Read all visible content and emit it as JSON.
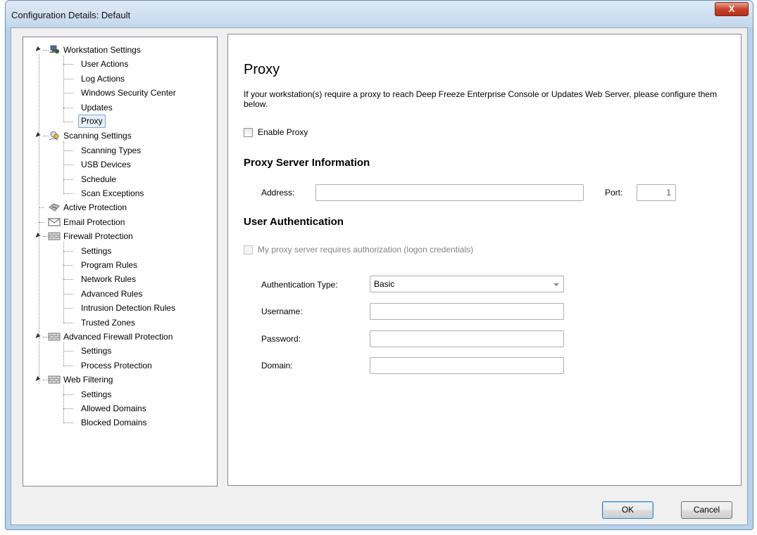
{
  "window": {
    "title": "Configuration Details: Default",
    "close_label": "X"
  },
  "tree": {
    "items": [
      {
        "label": "Workstation Settings",
        "level": 0,
        "icon": "workstation-icon"
      },
      {
        "label": "User Actions",
        "level": 1
      },
      {
        "label": "Log Actions",
        "level": 1
      },
      {
        "label": "Windows Security Center",
        "level": 1
      },
      {
        "label": "Updates",
        "level": 1
      },
      {
        "label": "Proxy",
        "level": 1,
        "selected": true
      },
      {
        "label": "Scanning Settings",
        "level": 0,
        "icon": "scanning-icon"
      },
      {
        "label": "Scanning Types",
        "level": 1
      },
      {
        "label": "USB Devices",
        "level": 1
      },
      {
        "label": "Schedule",
        "level": 1
      },
      {
        "label": "Scan Exceptions",
        "level": 1
      },
      {
        "label": "Active Protection",
        "level": 0,
        "icon": "active-protection-icon"
      },
      {
        "label": "Email Protection",
        "level": 0,
        "icon": "envelope-icon"
      },
      {
        "label": "Firewall Protection",
        "level": 0,
        "icon": "firewall-icon"
      },
      {
        "label": "Settings",
        "level": 1
      },
      {
        "label": "Program Rules",
        "level": 1
      },
      {
        "label": "Network Rules",
        "level": 1
      },
      {
        "label": "Advanced Rules",
        "level": 1
      },
      {
        "label": "Intrusion Detection Rules",
        "level": 1
      },
      {
        "label": "Trusted Zones",
        "level": 1
      },
      {
        "label": "Advanced Firewall Protection",
        "level": 0,
        "icon": "firewall-icon"
      },
      {
        "label": "Settings",
        "level": 1
      },
      {
        "label": "Process Protection",
        "level": 1
      },
      {
        "label": "Web Filtering",
        "level": 0,
        "icon": "firewall-icon"
      },
      {
        "label": "Settings",
        "level": 1
      },
      {
        "label": "Allowed Domains",
        "level": 1
      },
      {
        "label": "Blocked Domains",
        "level": 1
      }
    ]
  },
  "content": {
    "heading": "Proxy",
    "description": "If your workstation(s) require a proxy to reach Deep Freeze Enterprise Console or Updates Web Server, please configure them below.",
    "enable_proxy_label": "Enable Proxy",
    "enable_proxy_checked": false,
    "proxy_server_heading": "Proxy Server Information",
    "address_label": "Address:",
    "address_value": "",
    "port_label": "Port:",
    "port_value": "1",
    "user_auth_heading": "User Authentication",
    "requires_auth_label": "My proxy server requires authorization (logon credentials)",
    "requires_auth_checked": false,
    "auth_type_label": "Authentication Type:",
    "auth_type_value": "Basic",
    "username_label": "Username:",
    "username_value": "",
    "password_label": "Password:",
    "password_value": "",
    "domain_label": "Domain:",
    "domain_value": ""
  },
  "buttons": {
    "ok_label": "OK",
    "cancel_label": "Cancel"
  }
}
